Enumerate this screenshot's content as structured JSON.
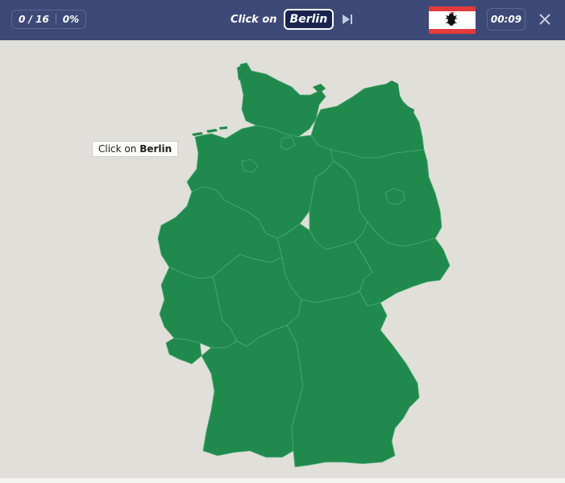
{
  "score": {
    "progress": "0 / 16",
    "percent": "0%"
  },
  "prompt": {
    "label": "Click on",
    "target": "Berlin"
  },
  "timer": "00:09",
  "tooltip": {
    "prefix": "Click on",
    "target": "Berlin"
  },
  "icons": {
    "skip": "skip-forward-icon",
    "close": "close-icon"
  },
  "colors": {
    "header": "#3d4a78",
    "land": "#1f8a4c",
    "background": "#e0dfd9",
    "flag_red": "#e33a3a"
  }
}
